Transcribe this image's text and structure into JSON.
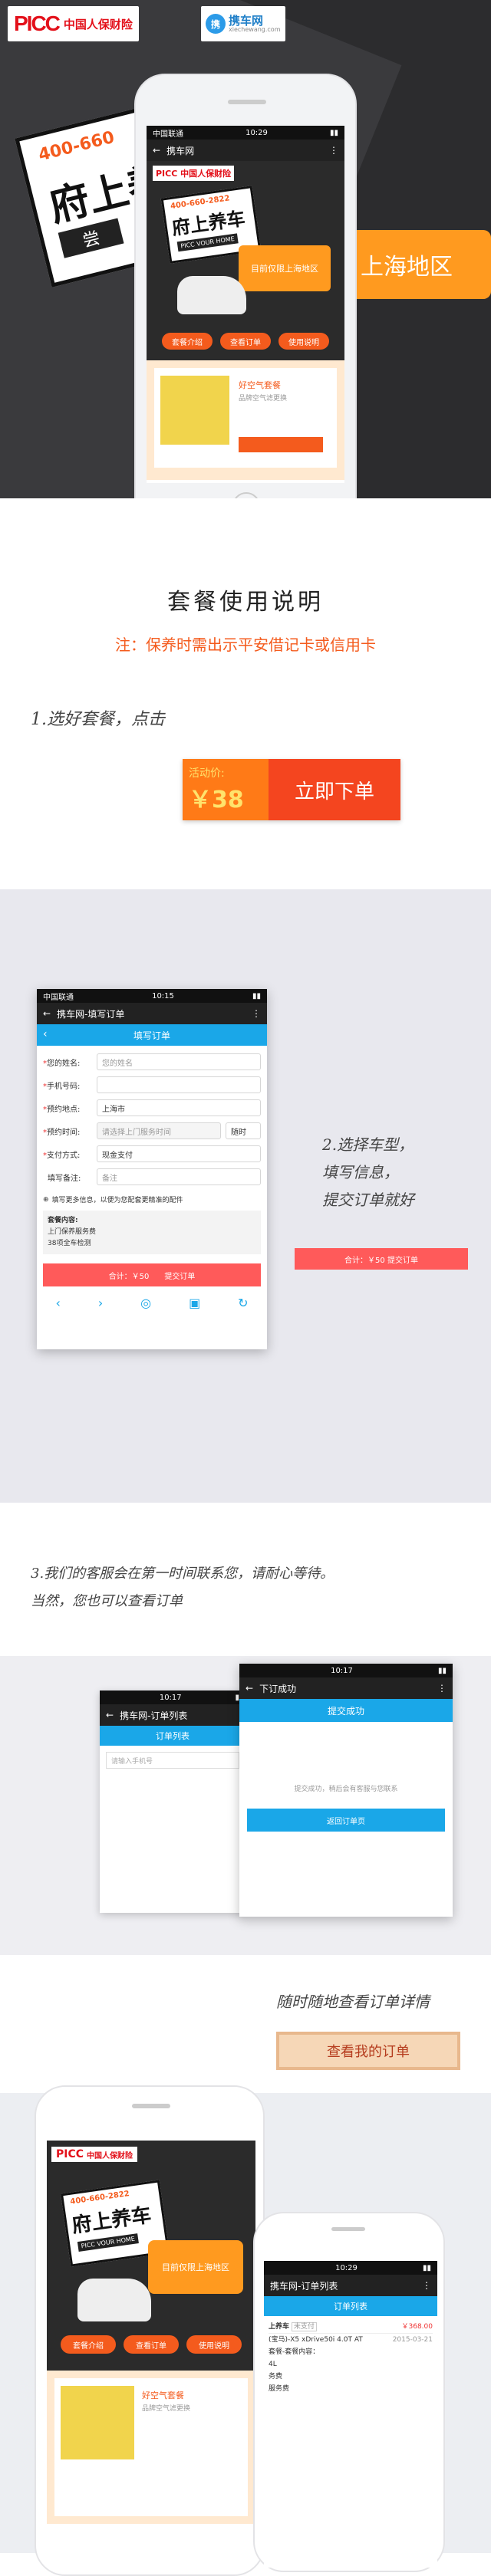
{
  "hero": {
    "picc_logo": "PICC",
    "picc_cn": "中国人保财险",
    "xiecheng_logo": "携车网",
    "xiecheng_sub": "xiechewang.com",
    "big_price": "400-660",
    "big_title": "府上养",
    "big_sub": "尝",
    "region_text": "上海地区",
    "phone": {
      "carrier": "中国联通",
      "time": "10:29",
      "nav_title": "携车网",
      "banner_price": "400-660-2822",
      "banner_title": "府上养车",
      "banner_en": "PICC VOUR HOME",
      "banner_region": "目前仅限上海地区",
      "btn1": "套餐介绍",
      "btn2": "查看订单",
      "btn3": "使用说明",
      "card_title": "好空气套餐",
      "card_sub": "品牌空气滤更换"
    }
  },
  "section_title": "套餐使用说明",
  "note": "注：保养时需出示平安借记卡或信用卡",
  "step1": {
    "text": "1.选好套餐，点击",
    "price_label": "活动价:",
    "price_value": "￥38",
    "order_label": "立即下单"
  },
  "step2": {
    "carrier": "中国联通",
    "time": "10:15",
    "nav_title": "携车网-填写订单",
    "header": "填写订单",
    "fields": [
      {
        "label": "您的姓名:",
        "value": "您的姓名",
        "required": true
      },
      {
        "label": "手机号码:",
        "value": "",
        "required": true
      },
      {
        "label": "预约地点:",
        "value": "上海市",
        "required": true
      },
      {
        "label": "预约时间:",
        "value": "请选择上门服务时间",
        "required": true
      },
      {
        "label": "支付方式:",
        "value": "现金支付",
        "required": true
      },
      {
        "label": "填写备注:",
        "value": "备注",
        "required": false
      }
    ],
    "time_suffix": "随时",
    "more_info": "填写更多信息，以便为您配套更精准的配件",
    "package_title": "套餐内容:",
    "package_line1": "上门保养服务费",
    "package_line2": "38项全车检测",
    "total": "合计：￥50",
    "submit": "提交订单",
    "side_text1": "2.选择车型，",
    "side_text2": "填写信息，",
    "side_text3": "提交订单就好",
    "side_btn": "合计：￥50     提交订单"
  },
  "step3": {
    "text1": "3.我们的客服会在第一时间联系您，请耐心等待。",
    "text2": "当然，您也可以查看订单",
    "back_time": "10:17",
    "back_nav": "携车网-订单列表",
    "back_header": "订单列表",
    "back_input": "请输入手机号",
    "front_time": "10:17",
    "front_nav": "下订成功",
    "front_header": "提交成功",
    "front_msg": "提交成功，稍后会有客服与您联系",
    "front_btn": "返回订单页"
  },
  "step4": {
    "text": "随时随地查看订单详情",
    "button": "查看我的订单",
    "phone_a": {
      "picc": "PICC",
      "cn": "中国人保财险",
      "price": "400-660-2822",
      "title": "府上养车",
      "en": "PICC VOUR HOME",
      "region": "目前仅限上海地区",
      "btn1": "套餐介绍",
      "btn2": "查看订单",
      "btn3": "使用说明",
      "card_title": "好空气套餐",
      "card_sub": "品牌空气滤更换"
    },
    "phone_b": {
      "time": "10:29",
      "nav": "携车网-订单列表",
      "header": "订单列表",
      "order_title": "上养车",
      "order_status": "未支付",
      "price": "￥368.00",
      "car": "(宝马)-X5 xDrive50i 4.0T AT",
      "date": "2015-03-21",
      "line1": "套餐-套餐内容：",
      "line2": "4L",
      "line3": "务费",
      "line4": "服务费"
    }
  }
}
